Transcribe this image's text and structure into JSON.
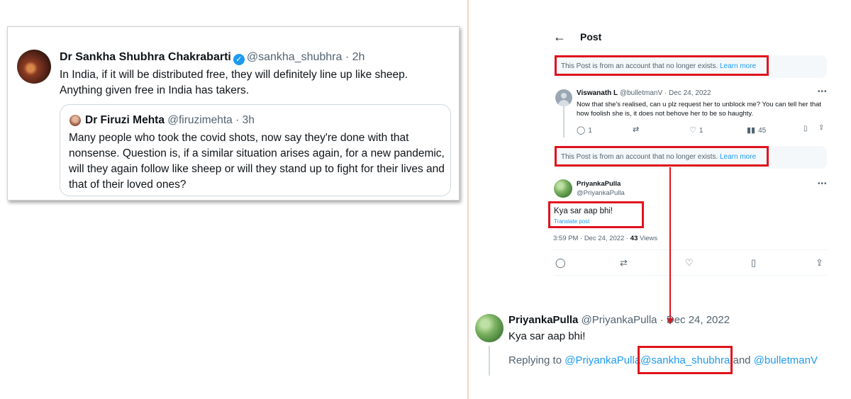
{
  "left_tweet": {
    "author_name": "Dr Sankha Shubhra Chakrabarti",
    "handle": "@sankha_shubhra",
    "time": "· 2h",
    "body": "In India, if it will be distributed free, they will definitely line up like sheep. Anything given free in India has takers.",
    "quote": {
      "author_name": "Dr Firuzi Mehta",
      "handle": "@firuzimehta",
      "time": "· 3h",
      "body": "Many people who took the covid shots, now say they're done with that nonsense. Question is, if a similar situation arises again, for a new pandemic, will they again follow like sheep or will they stand up to fight for their lives and that of their loved ones?"
    }
  },
  "right_panel": {
    "header": {
      "title": "Post"
    },
    "unavailable_notice": {
      "text": "This Post is from an account that no longer exists.",
      "link": "Learn more"
    },
    "reply1": {
      "name": "Viswanath L",
      "handle": "@bulletmanV",
      "date": "· Dec 24, 2022",
      "body": "Now that she's realised, can u plz request her to unblock me? You can tell her that how foolish she is, it does not behove her to be so haughty.",
      "replies": "1",
      "likes": "1",
      "views": "45"
    },
    "main_post": {
      "name": "PriyankaPulla",
      "handle": "@PriyankaPulla",
      "body": "Kya sar aap bhi!",
      "translate": "Translate post",
      "timestamp": "3:59 PM · Dec 24, 2022 ·",
      "views_count": "43",
      "views_label": "Views"
    }
  },
  "bottom_reply": {
    "name": "PriyankaPulla",
    "handle": "@PriyankaPulla",
    "date": "· Dec 24, 2022",
    "body": "Kya sar aap bhi!",
    "replying_to": "Replying to",
    "mention1": "@PriyankaPulla",
    "mention2": "@sankha_shubhra",
    "and_text": "and",
    "mention3": "@bulletmanV"
  },
  "colors": {
    "highlight_red": "#e0131d",
    "link_blue": "#1d9bf0",
    "verified_blue": "#1d9bf0"
  },
  "icons": [
    "back-arrow-icon",
    "verified-badge-icon",
    "reply-icon",
    "retweet-icon",
    "like-icon",
    "views-icon",
    "bookmark-icon",
    "share-icon",
    "more-icon"
  ]
}
